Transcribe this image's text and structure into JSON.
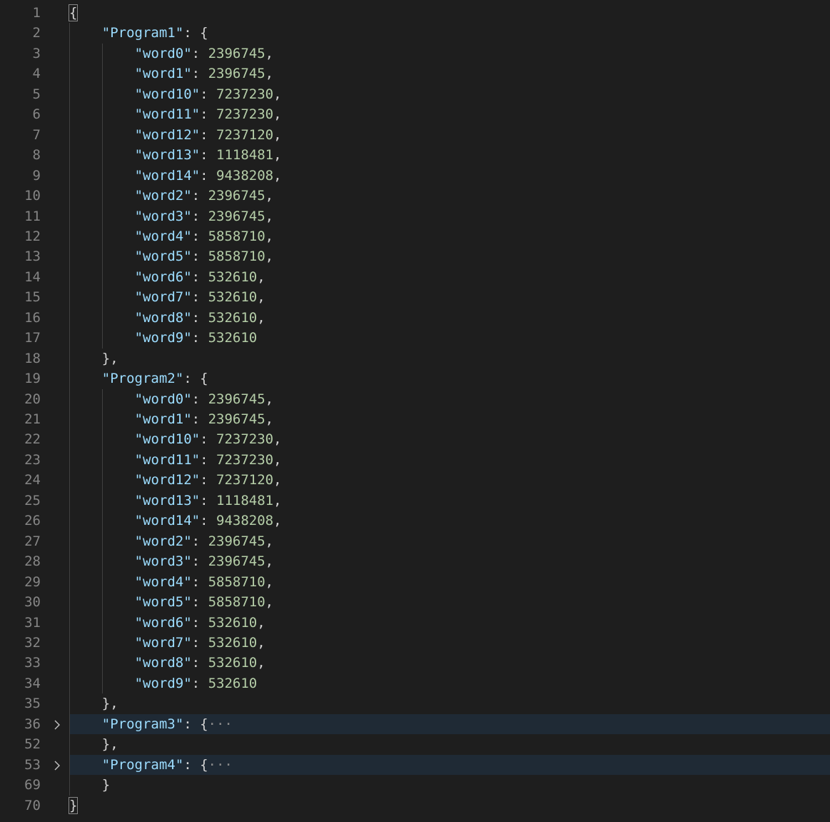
{
  "editor": {
    "lines": [
      {
        "num": "1",
        "indent": 0,
        "type": "open_root"
      },
      {
        "num": "2",
        "indent": 1,
        "type": "obj_open",
        "key": "\"Program1\""
      },
      {
        "num": "3",
        "indent": 2,
        "type": "kv",
        "key": "\"word0\"",
        "value": "2396745",
        "comma": true
      },
      {
        "num": "4",
        "indent": 2,
        "type": "kv",
        "key": "\"word1\"",
        "value": "2396745",
        "comma": true
      },
      {
        "num": "5",
        "indent": 2,
        "type": "kv",
        "key": "\"word10\"",
        "value": "7237230",
        "comma": true
      },
      {
        "num": "6",
        "indent": 2,
        "type": "kv",
        "key": "\"word11\"",
        "value": "7237230",
        "comma": true
      },
      {
        "num": "7",
        "indent": 2,
        "type": "kv",
        "key": "\"word12\"",
        "value": "7237120",
        "comma": true
      },
      {
        "num": "8",
        "indent": 2,
        "type": "kv",
        "key": "\"word13\"",
        "value": "1118481",
        "comma": true
      },
      {
        "num": "9",
        "indent": 2,
        "type": "kv",
        "key": "\"word14\"",
        "value": "9438208",
        "comma": true
      },
      {
        "num": "10",
        "indent": 2,
        "type": "kv",
        "key": "\"word2\"",
        "value": "2396745",
        "comma": true
      },
      {
        "num": "11",
        "indent": 2,
        "type": "kv",
        "key": "\"word3\"",
        "value": "2396745",
        "comma": true
      },
      {
        "num": "12",
        "indent": 2,
        "type": "kv",
        "key": "\"word4\"",
        "value": "5858710",
        "comma": true
      },
      {
        "num": "13",
        "indent": 2,
        "type": "kv",
        "key": "\"word5\"",
        "value": "5858710",
        "comma": true
      },
      {
        "num": "14",
        "indent": 2,
        "type": "kv",
        "key": "\"word6\"",
        "value": "532610",
        "comma": true
      },
      {
        "num": "15",
        "indent": 2,
        "type": "kv",
        "key": "\"word7\"",
        "value": "532610",
        "comma": true
      },
      {
        "num": "16",
        "indent": 2,
        "type": "kv",
        "key": "\"word8\"",
        "value": "532610",
        "comma": true
      },
      {
        "num": "17",
        "indent": 2,
        "type": "kv",
        "key": "\"word9\"",
        "value": "532610",
        "comma": false
      },
      {
        "num": "18",
        "indent": 1,
        "type": "close",
        "text": "},"
      },
      {
        "num": "19",
        "indent": 1,
        "type": "obj_open",
        "key": "\"Program2\""
      },
      {
        "num": "20",
        "indent": 2,
        "type": "kv",
        "key": "\"word0\"",
        "value": "2396745",
        "comma": true
      },
      {
        "num": "21",
        "indent": 2,
        "type": "kv",
        "key": "\"word1\"",
        "value": "2396745",
        "comma": true
      },
      {
        "num": "22",
        "indent": 2,
        "type": "kv",
        "key": "\"word10\"",
        "value": "7237230",
        "comma": true
      },
      {
        "num": "23",
        "indent": 2,
        "type": "kv",
        "key": "\"word11\"",
        "value": "7237230",
        "comma": true
      },
      {
        "num": "24",
        "indent": 2,
        "type": "kv",
        "key": "\"word12\"",
        "value": "7237120",
        "comma": true
      },
      {
        "num": "25",
        "indent": 2,
        "type": "kv",
        "key": "\"word13\"",
        "value": "1118481",
        "comma": true
      },
      {
        "num": "26",
        "indent": 2,
        "type": "kv",
        "key": "\"word14\"",
        "value": "9438208",
        "comma": true
      },
      {
        "num": "27",
        "indent": 2,
        "type": "kv",
        "key": "\"word2\"",
        "value": "2396745",
        "comma": true
      },
      {
        "num": "28",
        "indent": 2,
        "type": "kv",
        "key": "\"word3\"",
        "value": "2396745",
        "comma": true
      },
      {
        "num": "29",
        "indent": 2,
        "type": "kv",
        "key": "\"word4\"",
        "value": "5858710",
        "comma": true
      },
      {
        "num": "30",
        "indent": 2,
        "type": "kv",
        "key": "\"word5\"",
        "value": "5858710",
        "comma": true
      },
      {
        "num": "31",
        "indent": 2,
        "type": "kv",
        "key": "\"word6\"",
        "value": "532610",
        "comma": true
      },
      {
        "num": "32",
        "indent": 2,
        "type": "kv",
        "key": "\"word7\"",
        "value": "532610",
        "comma": true
      },
      {
        "num": "33",
        "indent": 2,
        "type": "kv",
        "key": "\"word8\"",
        "value": "532610",
        "comma": true
      },
      {
        "num": "34",
        "indent": 2,
        "type": "kv",
        "key": "\"word9\"",
        "value": "532610",
        "comma": false
      },
      {
        "num": "35",
        "indent": 1,
        "type": "close",
        "text": "},"
      },
      {
        "num": "36",
        "indent": 1,
        "type": "folded",
        "key": "\"Program3\"",
        "ellipsis": "···"
      },
      {
        "num": "52",
        "indent": 1,
        "type": "close",
        "text": "},"
      },
      {
        "num": "53",
        "indent": 1,
        "type": "folded",
        "key": "\"Program4\"",
        "ellipsis": "···"
      },
      {
        "num": "69",
        "indent": 1,
        "type": "close",
        "text": "}"
      },
      {
        "num": "70",
        "indent": 0,
        "type": "close_root",
        "text": "}"
      }
    ]
  },
  "colors": {
    "background": "#1e1e1e",
    "key": "#9cdcfe",
    "number": "#b5cea8",
    "punctuation": "#d4d4d4",
    "line_number": "#858585",
    "folded_highlight": "#1f2a35"
  },
  "icons": {
    "fold": "chevron-right-icon"
  }
}
